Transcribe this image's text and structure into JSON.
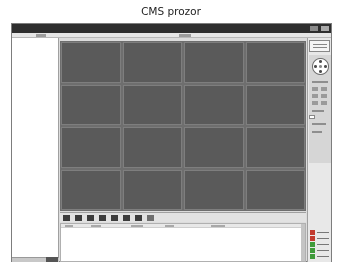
{
  "caption": "CMS prozor",
  "colors": {
    "status_red": "#c23a2e",
    "status_green": "#3f9a3a",
    "video_cell": "#5a5a5a"
  },
  "video_grid": {
    "rows": 4,
    "columns": 4
  },
  "toolbar_icons": [
    "layout-1-icon",
    "layout-4-icon",
    "layout-6-icon",
    "layout-8-icon",
    "layout-9-icon",
    "layout-13-icon",
    "layout-16-icon",
    "fullscreen-icon"
  ],
  "status_icons": [
    "alarm-icon",
    "alarm-icon",
    "device-online-icon",
    "device-online-icon",
    "device-online-icon"
  ]
}
